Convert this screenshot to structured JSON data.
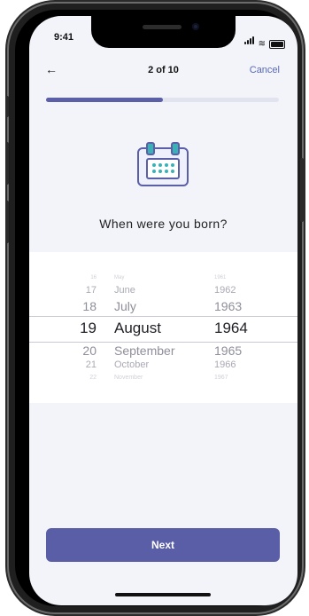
{
  "status_bar": {
    "time": "9:41"
  },
  "nav": {
    "back_icon": "←",
    "step": "2 of 10",
    "cancel": "Cancel"
  },
  "progress": {
    "current": 2,
    "total": 10,
    "fraction": 0.5,
    "fill_color": "#5b5fa8",
    "track_color": "#e1e3ef"
  },
  "question": "When were you born?",
  "picker": {
    "days": [
      "16",
      "17",
      "18",
      "19",
      "20",
      "21",
      "22"
    ],
    "months": [
      "May",
      "June",
      "July",
      "August",
      "September",
      "October",
      "November"
    ],
    "years": [
      "1961",
      "1962",
      "1963",
      "1964",
      "1965",
      "1966",
      "1967"
    ],
    "selected_index": 3
  },
  "next_button": "Next",
  "colors": {
    "accent": "#5a5ea7",
    "icon_accent": "#38b2b7",
    "background": "#f3f4f9"
  }
}
